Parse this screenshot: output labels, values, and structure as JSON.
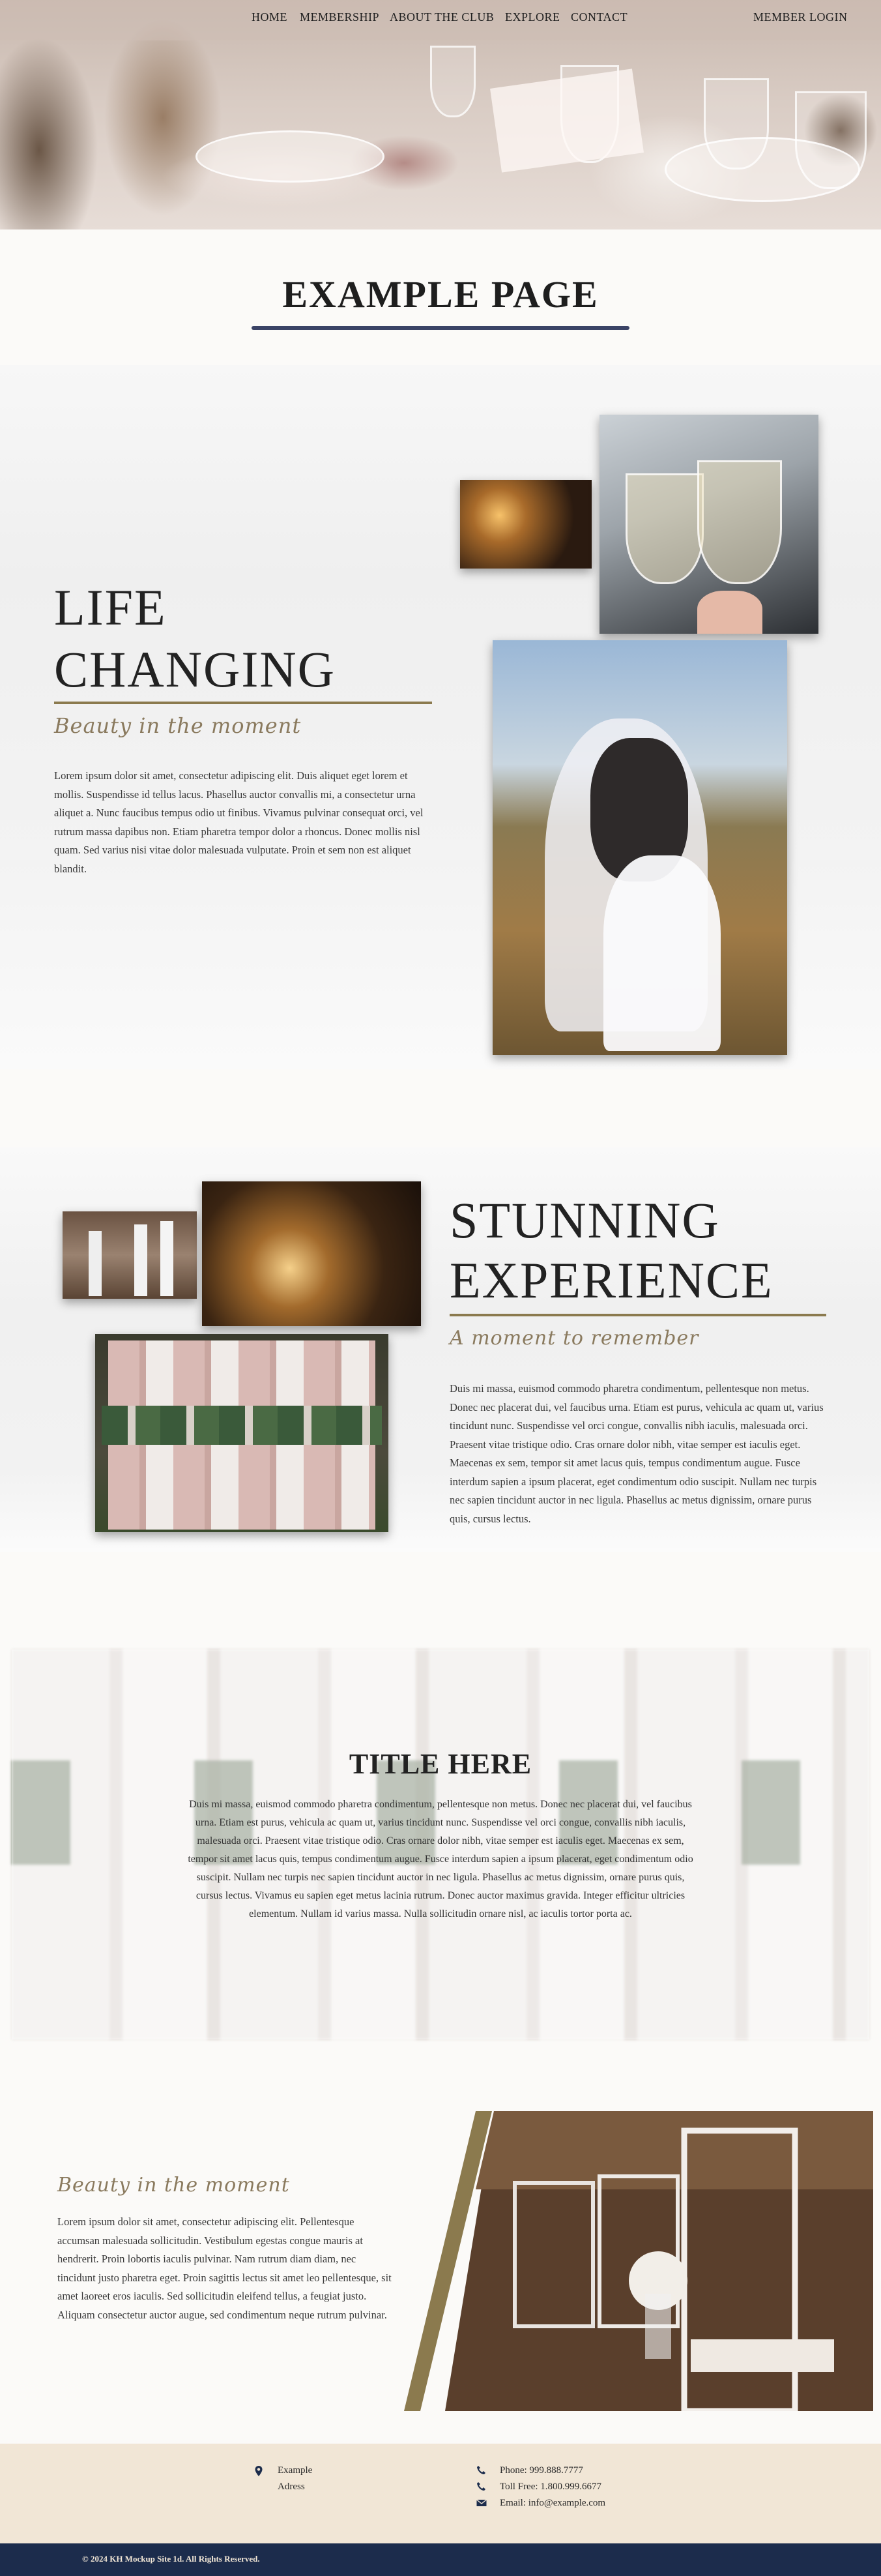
{
  "nav": {
    "items": [
      {
        "label": "HOME"
      },
      {
        "label": "MEMBERSHIP"
      },
      {
        "label": "ABOUT THE CLUB"
      },
      {
        "label": "EXPLORE"
      },
      {
        "label": "CONTACT"
      }
    ],
    "member_login": "MEMBER LOGIN"
  },
  "page_title": "EXAMPLE PAGE",
  "section1": {
    "heading_line1": "LIFE",
    "heading_line2": "CHANGING",
    "tagline": "Beauty in the moment",
    "body": "Lorem ipsum dolor sit amet, consectetur adipiscing elit. Duis aliquet eget lorem et mollis. Suspendisse id tellus lacus. Phasellus auctor convallis mi, a consectetur urna aliquet a. Nunc faucibus tempus odio ut finibus. Vivamus pulvinar consequat orci, vel rutrum massa dapibus non. Etiam pharetra tempor dolor a rhoncus. Donec mollis nisl quam. Sed varius nisi vitae dolor malesuada vulputate. Proin et sem non est aliquet blandit."
  },
  "section2": {
    "heading_line1": "STUNNING",
    "heading_line2": "EXPERIENCE",
    "tagline": "A moment to remember",
    "body": "Duis mi massa, euismod commodo pharetra condimentum, pellentesque non metus. Donec nec placerat dui, vel faucibus urna. Etiam est purus, vehicula ac quam ut, varius tincidunt nunc. Suspendisse vel orci congue, convallis nibh iaculis, malesuada orci. Praesent vitae tristique odio. Cras ornare dolor nibh, vitae semper est iaculis eget. Maecenas ex sem, tempor sit amet lacus quis, tempus condimentum augue. Fusce interdum sapien a ipsum placerat, eget condimentum odio suscipit. Nullam nec turpis nec sapien tincidunt auctor in nec ligula. Phasellus ac metus dignissim, ornare purus quis, cursus lectus."
  },
  "section3": {
    "title": "TITLE HERE",
    "body": "Duis mi massa, euismod commodo pharetra condimentum, pellentesque non metus. Donec nec placerat dui, vel faucibus urna. Etiam est purus, vehicula ac quam ut, varius tincidunt nunc. Suspendisse vel orci congue, convallis nibh iaculis, malesuada orci. Praesent vitae tristique odio. Cras ornare dolor nibh, vitae semper est iaculis eget. Maecenas ex sem, tempor sit amet lacus quis, tempus condimentum augue. Fusce interdum sapien a ipsum placerat, eget condimentum odio suscipit. Nullam nec turpis nec sapien tincidunt auctor in nec ligula. Phasellus ac metus dignissim, ornare purus quis, cursus lectus. Vivamus eu sapien eget metus lacinia rutrum. Donec auctor maximus gravida. Integer efficitur ultricies elementum. Nullam id varius massa. Nulla sollicitudin ornare nisl, ac iaculis tortor porta ac."
  },
  "section4": {
    "tagline": "Beauty in the moment",
    "body": "Lorem ipsum dolor sit amet, consectetur adipiscing elit. Pellentesque accumsan malesuada sollicitudin. Vestibulum egestas congue mauris at hendrerit. Proin lobortis iaculis pulvinar. Nam rutrum diam diam, nec tincidunt justo pharetra eget. Proin sagittis lectus sit amet leo pellentesque, sit amet laoreet eros iaculis. Sed sollicitudin eleifend tellus, a feugiat justo. Aliquam consectetur auctor augue, sed condimentum neque rutrum pulvinar."
  },
  "footer": {
    "address_line1": "Example",
    "address_line2": "Adress",
    "phone": "Phone: 999.888.7777",
    "toll_free": "Toll Free: 1.800.999.6677",
    "email": "Email: info@example.com",
    "copyright": "© 2024 KH Mockup Site 1d. All Rights Reserved.",
    "icons": [
      "map-pin-icon",
      "phone-icon",
      "phone-icon",
      "envelope-icon"
    ]
  },
  "colors": {
    "accent_navy": "#1c2c4c",
    "title_rule": "#3a4366",
    "gold": "#8b7a4e",
    "footer_bg": "#f1e6d6"
  }
}
